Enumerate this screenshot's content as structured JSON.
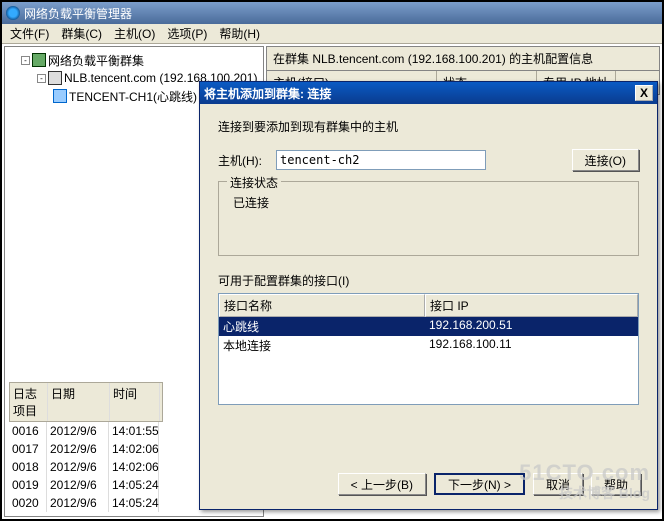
{
  "titlebar": {
    "title": "网络负载平衡管理器"
  },
  "menubar": {
    "file": "文件(F)",
    "cluster": "群集(C)",
    "host": "主机(O)",
    "options": "选项(P)",
    "help": "帮助(H)"
  },
  "tree": {
    "root": "网络负载平衡群集",
    "cluster": "NLB.tencent.com (192.168.100.201)",
    "host": "TENCENT-CH1(心跳线)"
  },
  "right": {
    "info_header": "在群集 NLB.tencent.com (192.168.100.201) 的主机配置信息",
    "col_host": "主机(接口)",
    "col_status": "状态",
    "col_ip": "专用 IP 地址"
  },
  "log": {
    "col1": "日志项目",
    "col2": "日期",
    "col3": "时间",
    "rows": [
      {
        "id": "0016",
        "date": "2012/9/6",
        "time": "14:01:55"
      },
      {
        "id": "0017",
        "date": "2012/9/6",
        "time": "14:02:06"
      },
      {
        "id": "0018",
        "date": "2012/9/6",
        "time": "14:02:06"
      },
      {
        "id": "0019",
        "date": "2012/9/6",
        "time": "14:05:24"
      },
      {
        "id": "0020",
        "date": "2012/9/6",
        "time": "14:05:24"
      }
    ]
  },
  "dialog": {
    "title": "将主机添加到群集:  连接",
    "close": "X",
    "desc": "连接到要添加到现有群集中的主机",
    "host_label": "主机(H):",
    "host_value": "tencent-ch2",
    "connect_btn": "连接(O)",
    "status_legend": "连接状态",
    "status_text": "已连接",
    "iface_label": "可用于配置群集的接口(I)",
    "lv_col1": "接口名称",
    "lv_col2": "接口 IP",
    "interfaces": [
      {
        "name": "心跳线",
        "ip": "192.168.200.51",
        "selected": true
      },
      {
        "name": "本地连接",
        "ip": "192.168.100.11",
        "selected": false
      }
    ],
    "btn_back": "< 上一步(B)",
    "btn_next": "下一步(N) >",
    "btn_cancel": "取消",
    "btn_help": "帮助"
  },
  "watermark": {
    "line1": "51CTO.com",
    "line2": "技术博客 Blog"
  }
}
